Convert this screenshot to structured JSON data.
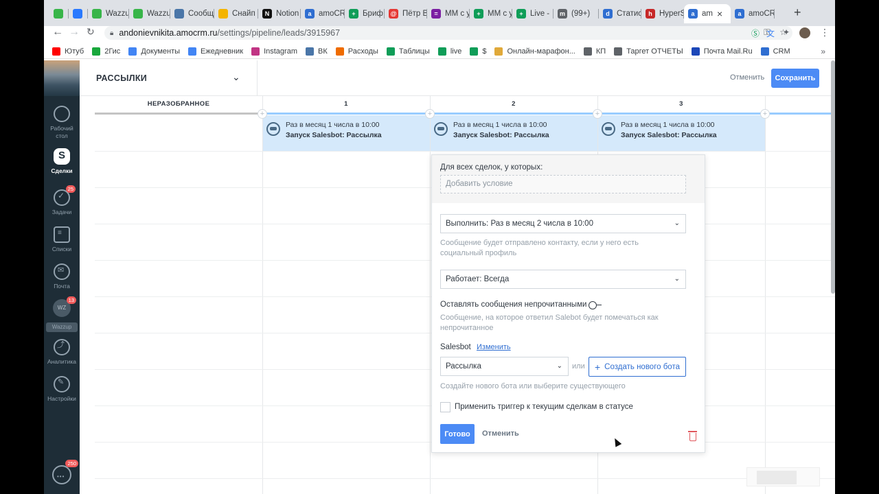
{
  "browser": {
    "tabs": [
      {
        "title": "",
        "color": "#38b549",
        "icon": "wz"
      },
      {
        "title": "",
        "color": "#2979ff",
        "icon": "msg"
      },
      {
        "title": "Wazzu",
        "color": "#38b549",
        "icon": "wz"
      },
      {
        "title": "Wazzu",
        "color": "#38b549",
        "icon": "wz"
      },
      {
        "title": "Сообщ",
        "color": "#4a76a8",
        "icon": "vk"
      },
      {
        "title": "Снайп",
        "color": "#f4b400",
        "icon": "drive"
      },
      {
        "title": "Notion",
        "color": "#111111",
        "icon": "N"
      },
      {
        "title": "amoCR",
        "color": "#2f6ed1",
        "icon": "a"
      },
      {
        "title": "Бриф",
        "color": "#0f9d58",
        "icon": "+"
      },
      {
        "title": "Пётр В",
        "color": "#e53935",
        "icon": "@"
      },
      {
        "title": "ММ с у",
        "color": "#7b1fa2",
        "icon": "="
      },
      {
        "title": "ММ с у",
        "color": "#0f9d58",
        "icon": "+"
      },
      {
        "title": "Live -",
        "color": "#0f9d58",
        "icon": "+"
      },
      {
        "title": "(99+)",
        "color": "#5f6368",
        "icon": "m"
      },
      {
        "title": "Статис",
        "color": "#2f6ed1",
        "icon": "d"
      },
      {
        "title": "HyperS",
        "color": "#c62828",
        "icon": "h"
      },
      {
        "title": "am",
        "color": "#2f6ed1",
        "icon": "a",
        "active": true
      },
      {
        "title": "amoCR",
        "color": "#2f6ed1",
        "icon": "a"
      }
    ],
    "url_host": "andonievnikita.amocrm.ru",
    "url_path": "/settings/pipeline/leads/3915967",
    "bookmarks": [
      {
        "label": "Ютуб",
        "color": "#ff0000"
      },
      {
        "label": "2Гис",
        "color": "#19a83c"
      },
      {
        "label": "Документы",
        "color": "#4285f4"
      },
      {
        "label": "Ежедневник",
        "color": "#4285f4"
      },
      {
        "label": "Instagram",
        "color": "#c13584"
      },
      {
        "label": "ВК",
        "color": "#4a76a8"
      },
      {
        "label": "Расходы",
        "color": "#ef6c00"
      },
      {
        "label": "Таблицы",
        "color": "#0f9d58"
      },
      {
        "label": "live",
        "color": "#0f9d58"
      },
      {
        "label": "$",
        "color": "#0f9d58"
      },
      {
        "label": "Онлайн-марафон...",
        "color": "#e0a93a"
      },
      {
        "label": "КП",
        "color": "#5f6368"
      },
      {
        "label": "Таргет ОТЧЕТЫ",
        "color": "#5f6368"
      },
      {
        "label": "Почта Mail.Ru",
        "color": "#1c47b8"
      },
      {
        "label": "CRM",
        "color": "#2f6ed1"
      }
    ],
    "bookmarks_more": "»"
  },
  "sidebar": {
    "items": [
      {
        "label": "Рабочий стол"
      },
      {
        "label": "Сделки",
        "active": true
      },
      {
        "label": "Задачи",
        "badge": "25"
      },
      {
        "label": "Списки"
      },
      {
        "label": "Почта"
      },
      {
        "label": "Аналитика"
      },
      {
        "label": "Настройки"
      }
    ],
    "wazzup": {
      "avatar": "WZ",
      "label": "Wazzup",
      "badge": "13"
    },
    "chat_badge": "250"
  },
  "header": {
    "pipeline_name": "РАССЫЛКИ",
    "cancel": "Отменить",
    "save": "Сохранить"
  },
  "columns": [
    {
      "title": "НЕРАЗОБРАННОЕ",
      "color": "#c4c4c4"
    },
    {
      "title": "1",
      "color": "#99ccff"
    },
    {
      "title": "2",
      "color": "#99ccff"
    },
    {
      "title": "3",
      "color": "#99ccff"
    }
  ],
  "triggers": [
    {
      "schedule": "Раз в месяц 1 числа в 10:00",
      "action": "Запуск Salesbot: Рассылка"
    },
    {
      "schedule": "Раз в месяц 1 числа в 10:00",
      "action": "Запуск Salesbot: Рассылка"
    },
    {
      "schedule": "Раз в месяц 1 числа в 10:00",
      "action": "Запуск Salesbot: Рассылка"
    }
  ],
  "popup": {
    "cond_label": "Для всех сделок, у которых:",
    "add_condition": "Добавить условие",
    "execute_select": "Выполнить: Раз в месяц 2 числа в 10:00",
    "execute_hint": "Сообщение будет отправлено контакту, если у него есть социальный профиль",
    "works_select": "Работает: Всегда",
    "unread_label": "Оставлять сообщения непрочитанными",
    "unread_hint": "Сообщение, на которое ответил Salebot будет помечаться как непрочитанное",
    "salesbot_label": "Salesbot",
    "change_link": "Изменить",
    "bot_select": "Рассылка",
    "or": "или",
    "create_bot": "Создать нового бота",
    "create_hint": "Создайте нового бота или выберите существующего",
    "apply_label": "Применить триггер к текущим сделкам в статусе",
    "done": "Готово",
    "cancel": "Отменить"
  }
}
